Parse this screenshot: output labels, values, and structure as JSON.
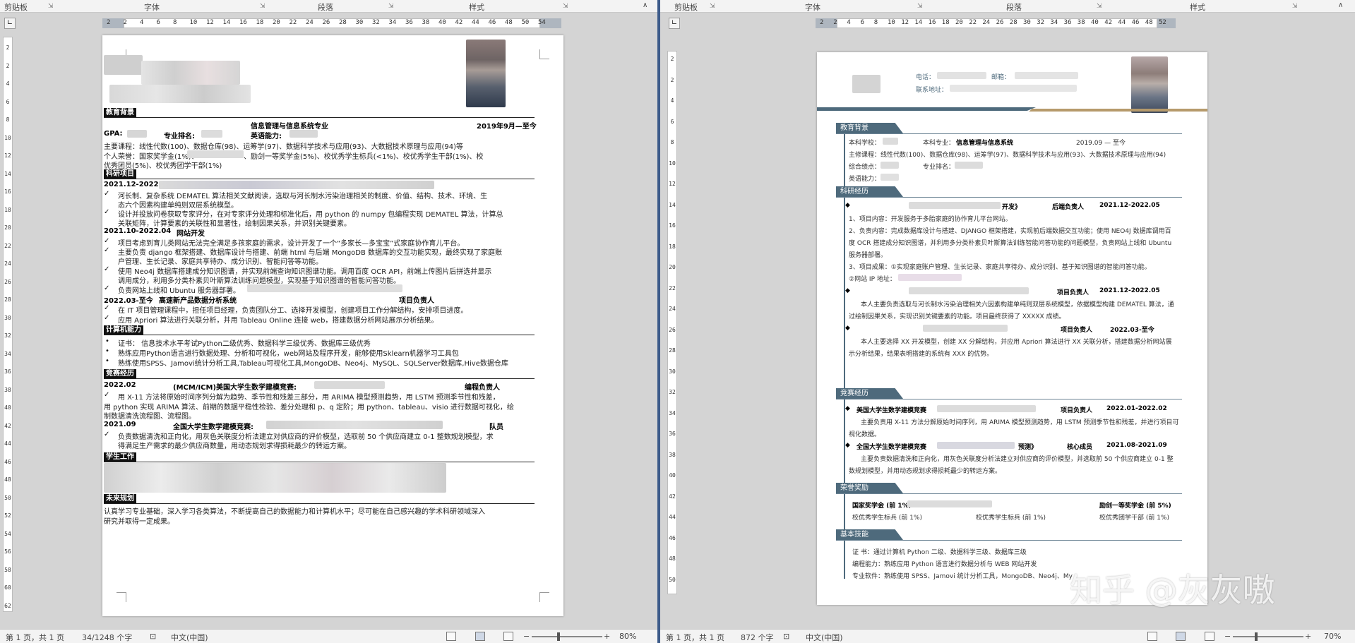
{
  "left": {
    "ribbon": {
      "clipboard": "剪贴板",
      "font": "字体",
      "paragraph": "段落",
      "styles": "样式"
    },
    "ruler_ticks": [
      "2",
      "2",
      "4",
      "6",
      "8",
      "10",
      "12",
      "14",
      "16",
      "18",
      "20",
      "22",
      "24",
      "26",
      "28",
      "30",
      "32",
      "34",
      "36",
      "38",
      "40",
      "42",
      "44",
      "46",
      "48",
      "50",
      "54"
    ],
    "vruler_ticks": [
      "2",
      "2",
      "4",
      "6",
      "8",
      "10",
      "12",
      "14",
      "16",
      "18",
      "20",
      "22",
      "24",
      "26",
      "28",
      "30",
      "32",
      "34",
      "36",
      "38",
      "40",
      "42",
      "44",
      "46",
      "48",
      "50",
      "52",
      "54",
      "56",
      "58",
      "60",
      "62"
    ],
    "resume": {
      "edu_title": "教育背景",
      "major": "信息管理与信息系统专业",
      "date": "2019年9月—至今",
      "gpa": "GPA:",
      "rank": "专业排名:",
      "english": "英语能力:",
      "courses": "主要课程：线性代数(100)、数据仓库(98)、运筹学(97)、数据科学技术与应用(93)、大数据技术原理与应用(94)等",
      "honors1a": "个人荣誉：国家奖学金(1%)、",
      "honors1b": "、励剑一等奖学金(5%)、校优秀学生标兵(<1%)、校优秀学生干部(1%)、校",
      "honors2": "优秀团员(5%)、校优秀团学干部(1%)",
      "research_title": "科研项目",
      "proj1_date": "2021.12-2022.05",
      "proj1_b1": "河长制、复杂系统 DEMATEL 算法相关文献阅读，选取与河长制水污染治理相关的制度、价值、结构、技术、环境、生",
      "proj1_b1b": "态六个因素构建单纯则双层系统模型。",
      "proj1_b2": "设计并投放问卷获取专家评分，在对专家评分处理和标准化后，用 python 的 numpy 包编程实现 DEMATEL 算法，计算总",
      "proj1_b2b": "关联矩阵，计算要素的关联性和显著性，绘制因果关系，并识别关键要素。",
      "proj2_date": "2021.10-2022.04",
      "proj2_name": "网站开发",
      "proj2_b1": "项目考虑到育儿类网站无法完全满足多孩家庭的需求，设计开发了一个“多家长—多宝宝”式家庭协作育儿平台。",
      "proj2_b2": "主要负责 django 框架搭建、数据库设计与搭建、前端 html 与后端 MongoDB 数据库的交互功能实现，最终实现了家庭账",
      "proj2_b2b": "户管理、生长记录、家庭共享待办、成分识别、智能问答等功能。",
      "proj2_b3": "使用 Neo4j 数据库搭建成分知识图谱，并实现前端查询知识图谱功能。调用百度 OCR API，前端上传图片后拼选并显示",
      "proj2_b3b": "调用成分，利用多分类朴素贝叶斯算法训练问题模型，实现基于知识图谱的智能问答功能。",
      "proj2_b4": "负责网站上线和 Ubuntu 服务器部署。",
      "proj3_date": "2022.03-至今",
      "proj3_name": "高速新产品数据分析系统",
      "proj3_role": "项目负责人",
      "proj3_b1": "在 IT 项目管理课程中，担任项目经理，负责团队分工、选择开发模型，创建项目工作分解结构，安排项目进度。",
      "proj3_b2": "应用 Apriori 算法进行关联分析，并用 Tableau Online 连接 web，搭建数据分析网站展示分析结果。",
      "skills_title": "计算机能力",
      "skill1": "证书：       信息技术水平考试Python二级优秀、数据科学三级优秀、数据库三级优秀",
      "skill2": "熟练应用Python语言进行数据处理、分析和可视化，web网站及程序开发，能够使用Sklearn机器学习工具包",
      "skill3": "熟练使用SPSS、Jamovi统计分析工具,Tableau可视化工具,MongoDB、Neo4j、MySQL、SQLServer数据库,Hive数据仓库",
      "comp_title": "竞赛经历",
      "comp1_date": "2022.02",
      "comp1_name": "(MCM/ICM)美国大学生数学建模竞赛:",
      "comp1_role": "编程负责人",
      "comp1_b1": "用 X-11 方法将原始时间序列分解为趋势、季节性和残差三部分，用 ARIMA 模型预测趋势，用 LSTM 预测季节性和残差，",
      "comp1_b1b": "用 python 实现 ARIMA 算法、前期的数据平稳性检验、差分处理和 p、q 定阶；用 python、tableau、visio 进行数据可视化，绘",
      "comp1_b1c": "制数据清洗流程图、流程图。",
      "comp2_date": "2021.09",
      "comp2_name": "全国大学生数学建模竞赛:",
      "comp2_role": "队员",
      "comp2_b1": "负责数据清洗和正向化，用灰色关联度分析法建立对供应商的评价模型，选取前 50 个供应商建立 0-1 整数规划模型，求",
      "comp2_b1b": "得满足生产需求的最少供应商数量，用动态规划求得损耗最少的转运方案。",
      "work_title": "学生工作",
      "future_title": "未来规划",
      "future1": "认真学习专业基础，深入学习各类算法，不断提高自己的数据能力和计算机水平；尽可能在自己感兴趣的学术科研领域深入",
      "future2": "研究并取得一定成果。"
    },
    "status": {
      "pages": "第 1 页，共 1 页",
      "words": "34/1248 个字",
      "lang": "中文(中国)",
      "zoom": "80%"
    }
  },
  "right": {
    "ribbon": {
      "clipboard": "剪贴板",
      "font": "字体",
      "paragraph": "段落",
      "styles": "样式"
    },
    "ruler_ticks": [
      "2",
      "2",
      "4",
      "6",
      "8",
      "10",
      "12",
      "14",
      "16",
      "18",
      "20",
      "22",
      "24",
      "26",
      "28",
      "30",
      "32",
      "34",
      "36",
      "38",
      "40",
      "42",
      "44",
      "46",
      "48",
      "52"
    ],
    "vruler_ticks": [
      "2",
      "2",
      "4",
      "6",
      "8",
      "10",
      "12",
      "14",
      "16",
      "18",
      "20",
      "22",
      "24",
      "26",
      "28",
      "30",
      "32",
      "34",
      "36",
      "38",
      "40",
      "42",
      "44",
      "46",
      "48",
      "50"
    ],
    "resume": {
      "phone": "电话：",
      "email": "邮箱：",
      "address": "联系地址：",
      "edu_title": "教育背景",
      "school": "本科学校：",
      "major_label": "本科专业：",
      "major": "信息管理与信息系统",
      "date": "2019.09 — 至今",
      "courses": "主修课程：线性代数(100)、数据仓库(98)、运筹学(97)、数据科学技术与应用(93)、大数据技术原理与应用(94)",
      "gpa": "综合绩点：",
      "rank": "专业排名：",
      "english": "英语能力：",
      "research_title": "科研经历",
      "r1_name": "开发》",
      "r1_role": "后端负责人",
      "r1_date": "2021.12-2022.05",
      "r1_l1": "1、项目内容：开发服务于多胎家庭的协作育儿平台网站。",
      "r1_l2": "2、负责内容：完成数据库设计与搭建、DJANGO 框架搭建，实现前后端数据交互功能；使用 NEO4J 数据库调用百",
      "r1_l2b": "度 OCR 搭建成分知识图谱，并利用多分类朴素贝叶斯算法训练智能问答功能的问题模型，负责网站上线和 Ubuntu",
      "r1_l2c": "服务器部署。",
      "r1_l3": "3、项目成果：①实现家庭账户管理、生长记录、家庭共享待办、成分识别、基于知识图谱的智能问答功能。",
      "r1_l3b": "②网站 IP 地址：",
      "r2_role": "项目负责人",
      "r2_date": "2021.12-2022.05",
      "r2_l1": "本人主要负责选取与河长制水污染治理相关六因素构建单纯则双层系统模型，依据模型构建 DEMATEL 算法，通",
      "r2_l1b": "过绘制因果关系，实现识别关键要素的功能。项目最终获得了 XXXXX 成绩。",
      "r3_role": "项目负责人",
      "r3_date": "2022.03-至今",
      "r3_l1": "本人主要选择 XX 开发模型，创建 XX 分解结构，并应用 Apriori 算法进行 XX 关联分析，搭建数据分析网站展",
      "r3_l1b": "示分析结果，结果表明搭建的系统有 XXX 的优势。",
      "comp_title": "竞赛经历",
      "c1_name": "美国大学生数学建模竞赛",
      "c1_role": "项目负责人",
      "c1_date": "2022.01-2022.02",
      "c1_l1": "主要负责用 X-11 方法分解原始时间序列，用 ARIMA 模型预测趋势，用 LSTM 预测季节性和残差，并进行项目可",
      "c1_l1b": "视化数据。",
      "c2_name": "全国大学生数学建模竞赛",
      "c2_suffix": "预测》",
      "c2_role": "核心成员",
      "c2_date": "2021.08-2021.09",
      "c2_l1": "主要负责数据清洗和正向化，用灰色关联度分析法建立对供应商的评价模型，并选取前 50 个供应商建立 0-1 整",
      "c2_l1b": "数规划模型，并用动态规划求得损耗最少的转运方案。",
      "honor_title": "荣誉奖励",
      "h1": "国家奖学金 (前 1%)",
      "h2": "励剑一等奖学金 (前 5%)",
      "h3": "校优秀学生标兵 (前 1%)",
      "h4": "校优秀学生标兵 (前 1%)",
      "h5": "校优秀团学干部 (前 1%)",
      "skills_title": "基本技能",
      "s1": "证     书：通过计算机 Python 二级、数据科学三级、数据库三级",
      "s2": "编程能力：熟练应用 Python 语言进行数据分析与 WEB 网站开发",
      "s3": "专业软件：熟练使用 SPSS、Jamovi 统计分析工具，MongoDB、Neo4j、My"
    },
    "status": {
      "pages": "第 1 页，共 1 页",
      "words": "872 个字",
      "lang": "中文(中国)",
      "zoom": "70%"
    }
  },
  "watermark": "知乎 @灰灰嗷",
  "colors": {
    "accent": "#4e6a7c",
    "gold": "#b69a6b",
    "split": "#3d5b8a"
  }
}
